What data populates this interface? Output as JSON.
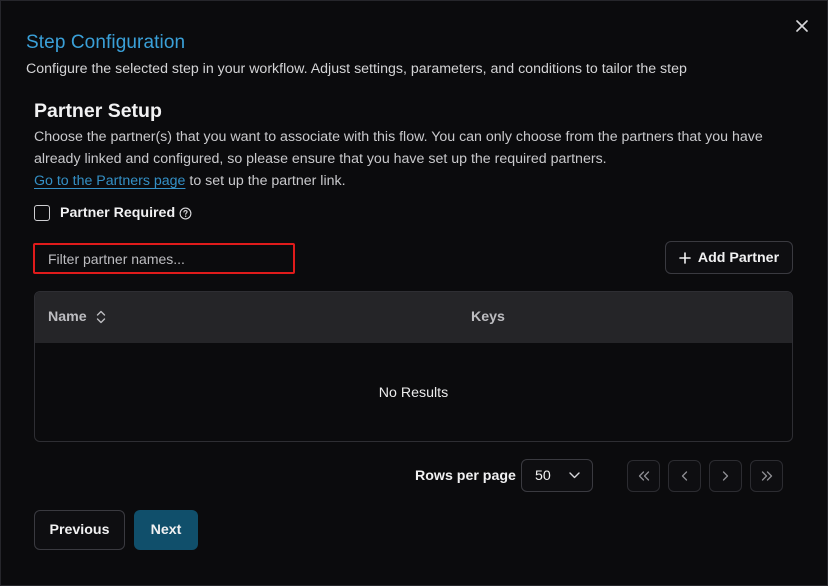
{
  "dialog": {
    "title": "Step Configuration",
    "subtitle": "Configure the selected step in your workflow. Adjust settings, parameters, and conditions to tailor the step",
    "close_icon": "close-icon"
  },
  "partner_setup": {
    "title": "Partner Setup",
    "description": "Choose the partner(s) that you want to associate with this flow. You can only choose from the partners that you have already linked and configured, so please ensure that you have set up the required partners.",
    "link_text": "Go to the Partners page",
    "link_suffix": " to set up the partner link.",
    "required_label": "Partner Required",
    "required_checked": false,
    "help_icon": "help-circle-icon"
  },
  "filter": {
    "placeholder": "Filter partner names...",
    "value": ""
  },
  "add_partner": {
    "label": "Add Partner",
    "icon": "plus-icon"
  },
  "table": {
    "columns": [
      "Name",
      "Keys"
    ],
    "sort_icon": "sort-updown-icon",
    "empty_text": "No Results"
  },
  "pagination": {
    "rows_label": "Rows per page",
    "rows_value": "50",
    "select_icon": "chevron-down-icon",
    "buttons": [
      "first-page-icon",
      "prev-page-icon",
      "next-page-icon",
      "last-page-icon"
    ]
  },
  "footer": {
    "previous_label": "Previous",
    "next_label": "Next"
  },
  "colors": {
    "accent": "#3aa0d8",
    "link": "#3490c6",
    "primary_button": "#104f6b",
    "highlight_border": "#e01b1b"
  }
}
